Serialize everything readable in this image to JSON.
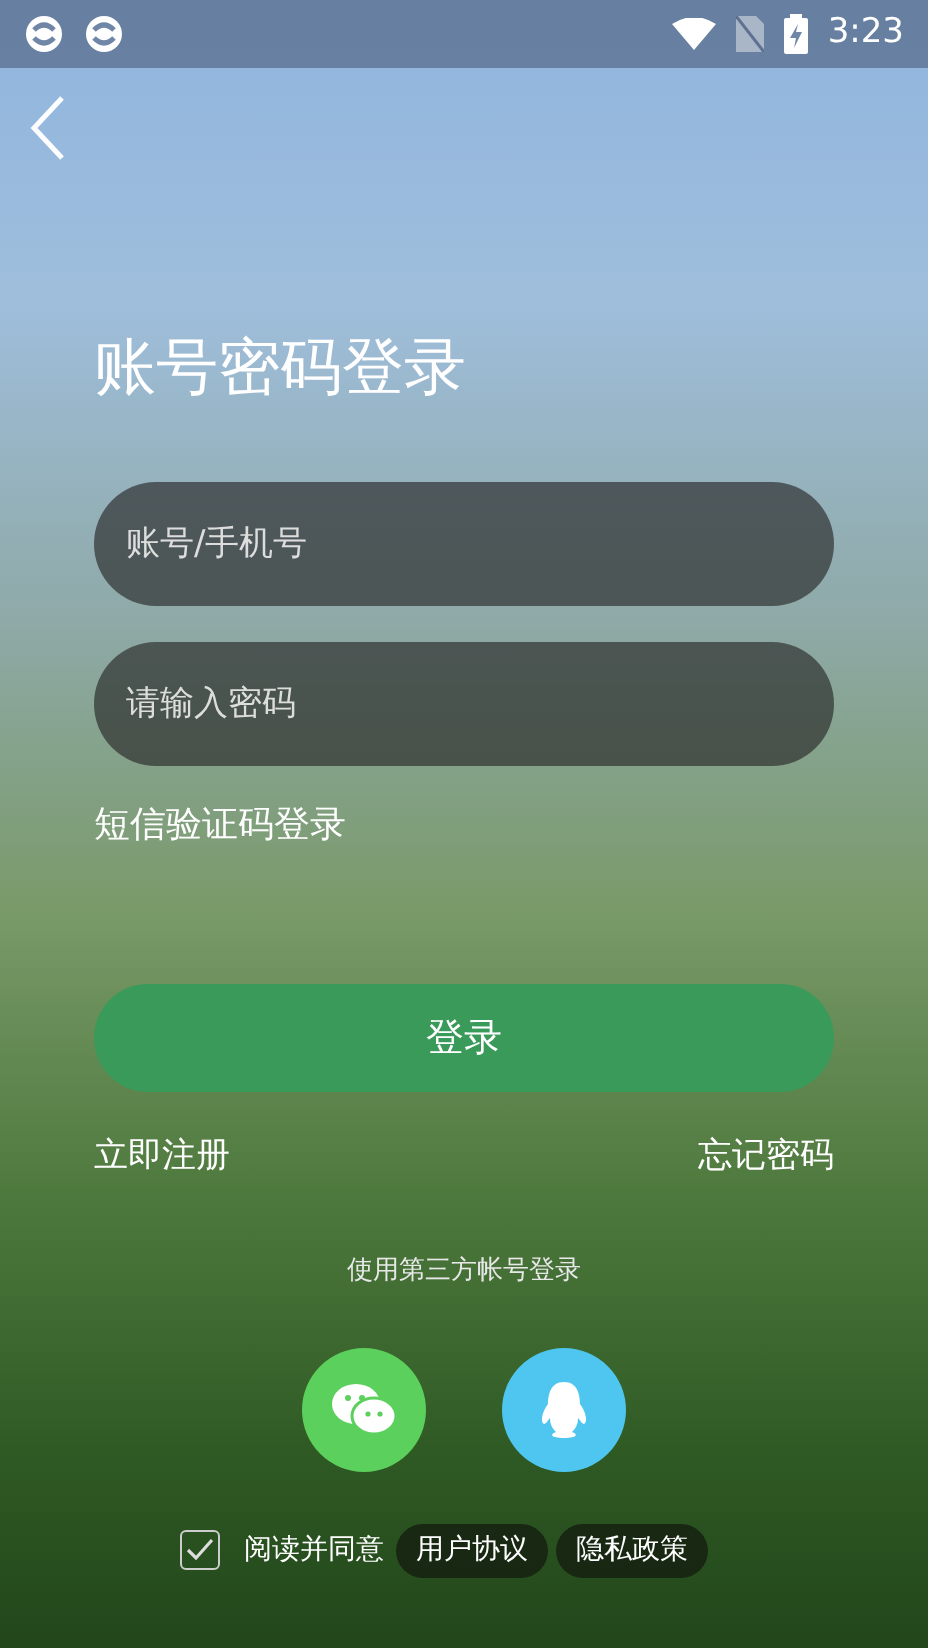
{
  "status_bar": {
    "time": "3:23"
  },
  "title": "账号密码登录",
  "fields": [
    {
      "placeholder": "账号/手机号"
    },
    {
      "placeholder": "请输入密码"
    }
  ],
  "sms_login": "短信验证码登录",
  "login_button": "登录",
  "register": "立即注册",
  "forgot_password": "忘记密码",
  "third_party_label": "使用第三方帐号登录",
  "agreement": {
    "checked": true,
    "text": "阅读并同意",
    "links": [
      "用户协议",
      "隐私政策"
    ]
  }
}
